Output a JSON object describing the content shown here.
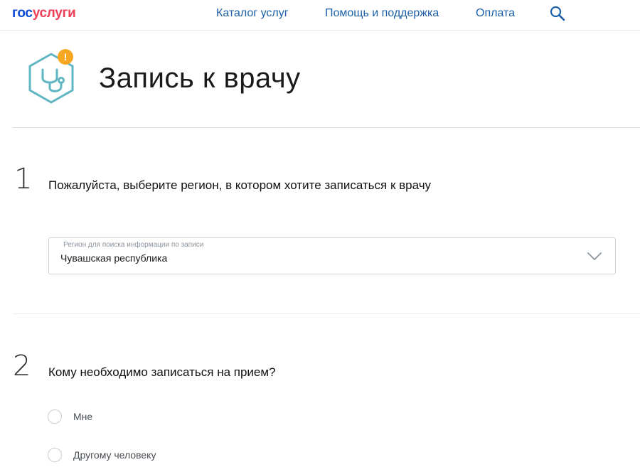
{
  "header": {
    "logo_part1": "гос",
    "logo_part2": "услуги",
    "nav": {
      "catalog": "Каталог услуг",
      "help": "Помощь и поддержка",
      "payment": "Оплата"
    },
    "search_icon": "search-icon"
  },
  "service": {
    "icon": "stethoscope-icon",
    "alert_badge": "!",
    "title": "Запись к врачу"
  },
  "step1": {
    "number": "1",
    "question": "Пожалуйста, выберите регион, в котором хотите записаться к врачу",
    "select": {
      "label": "Регион для поиска информации по записи",
      "value": "Чувашская республика"
    }
  },
  "step2": {
    "number": "2",
    "question": "Кому необходимо записаться на прием?",
    "options": [
      {
        "label": "Мне",
        "selected": false
      },
      {
        "label": "Другому человеку",
        "selected": false
      }
    ]
  },
  "colors": {
    "brand_blue": "#0d4cd3",
    "brand_red": "#ee3f58",
    "link_blue": "#1b5fa8",
    "icon_teal": "#5fb6c2",
    "badge_orange": "#f7a823"
  }
}
